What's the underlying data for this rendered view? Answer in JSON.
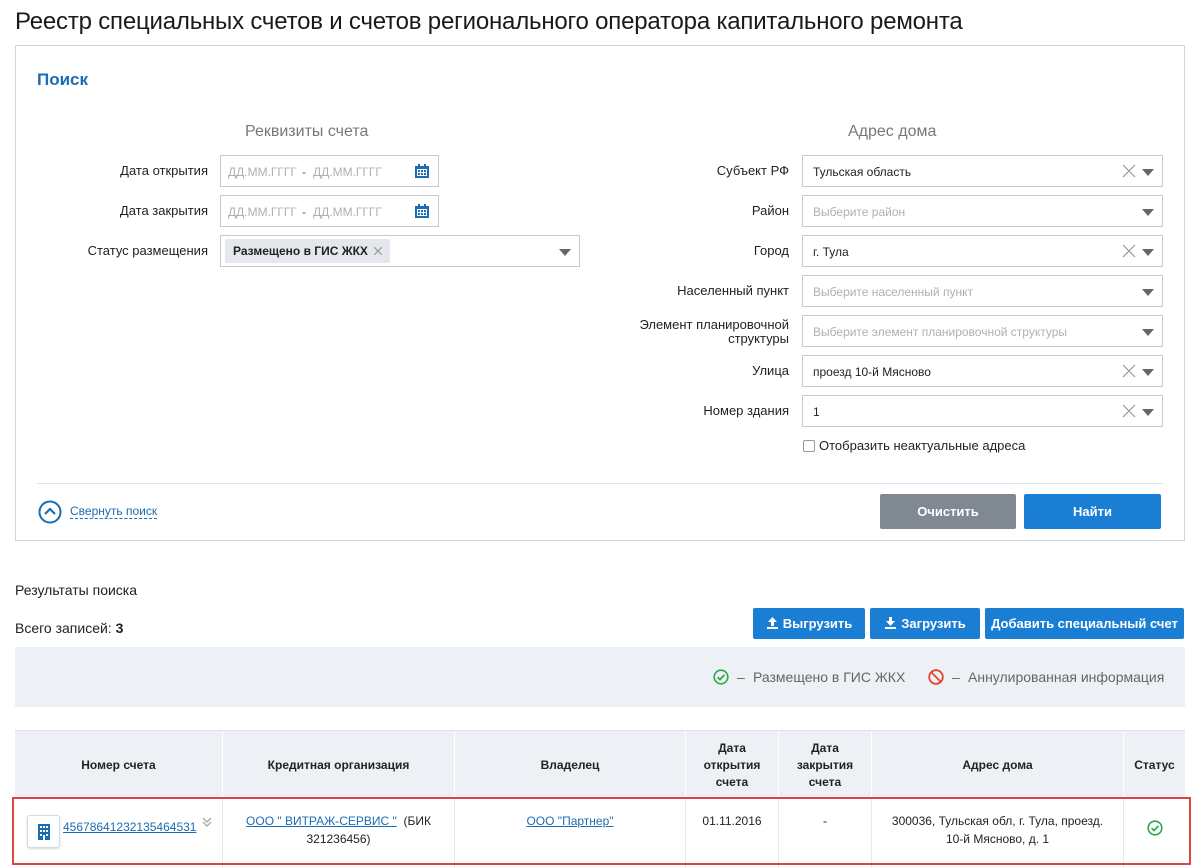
{
  "page": {
    "title": "Реестр специальных счетов и счетов регионального оператора капитального ремонта"
  },
  "search": {
    "title": "Поиск",
    "left_section": "Реквизиты счета",
    "right_section": "Адрес дома",
    "open_date": {
      "label": "Дата открытия",
      "from_placeholder": "ДД.ММ.ГГГГ",
      "sep": "-",
      "to_placeholder": "ДД.ММ.ГГГГ"
    },
    "close_date": {
      "label": "Дата закрытия",
      "from_placeholder": "ДД.ММ.ГГГГ",
      "sep": "-",
      "to_placeholder": "ДД.ММ.ГГГГ"
    },
    "status": {
      "label": "Статус размещения",
      "tag": "Размещено в ГИС ЖКХ"
    },
    "subject": {
      "label": "Субъект РФ",
      "value": "Тульская область"
    },
    "district": {
      "label": "Район",
      "placeholder": "Выберите район"
    },
    "city": {
      "label": "Город",
      "value": "г. Тула"
    },
    "locality": {
      "label": "Населенный пункт",
      "placeholder": "Выберите населенный пункт"
    },
    "plan_element": {
      "label_line1": "Элемент планировочной",
      "label_line2": "структуры",
      "placeholder": "Выберите элемент планировочной структуры"
    },
    "street": {
      "label": "Улица",
      "value": "проезд 10-й Мясново"
    },
    "building": {
      "label": "Номер здания",
      "value": "1"
    },
    "show_inactive": {
      "label": "Отобразить неактуальные адреса",
      "checked": false
    },
    "collapse_label": "Свернуть поиск",
    "clear_label": "Очистить",
    "find_label": "Найти"
  },
  "results": {
    "title": "Результаты поиска",
    "total_label": "Всего записей:",
    "total_count": "3",
    "export_label": "Выгрузить",
    "import_label": "Загрузить",
    "add_label": "Добавить специальный счет",
    "legend": {
      "posted_sep": "–",
      "posted": "Размещено в ГИС ЖКХ",
      "annulled_sep": "–",
      "annulled": "Аннулированная информация"
    },
    "columns": {
      "account": "Номер счета",
      "bank": "Кредитная организация",
      "owner": "Владелец",
      "open_date": "Дата открытия счета",
      "close_date": "Дата закрытия счета",
      "address": "Адрес дома",
      "status": "Статус"
    },
    "rows": [
      {
        "account": "45678641232135464531",
        "bank_name": "ООО \" ВИТРАЖ-СЕРВИС \"",
        "bank_bik": "(БИК 321236456)",
        "owner": "ООО \"Партнер\"",
        "open_date": "01.11.2016",
        "close_date": "-",
        "address": "300036, Тульская обл, г. Тула, проезд. 10-й Мясново, д. 1",
        "status": "posted"
      }
    ]
  },
  "colors": {
    "accent": "#1a7fd4",
    "link": "#1a6cb5",
    "posted": "#2aa84a",
    "annulled": "#e0452e",
    "highlight": "#d94646"
  }
}
